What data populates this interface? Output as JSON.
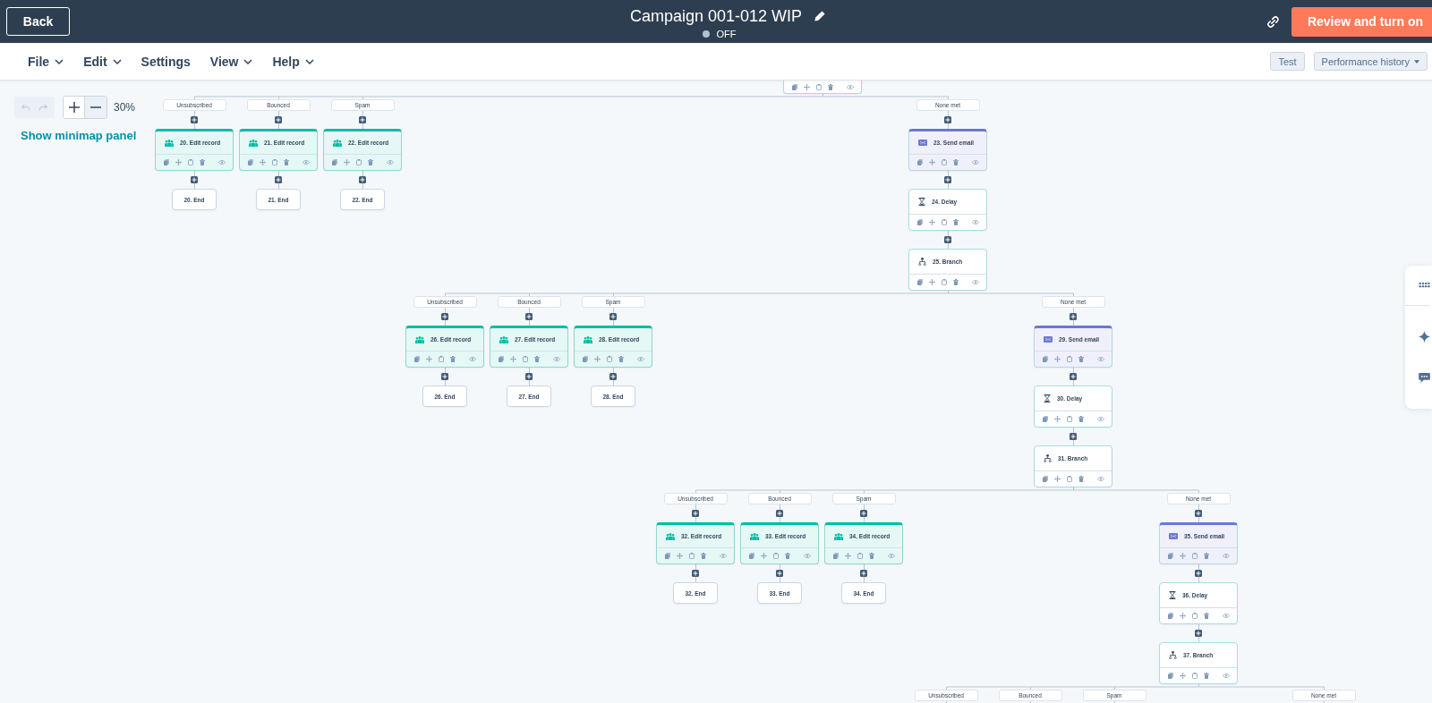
{
  "header": {
    "back_button": "Back",
    "title": "Campaign 001-012 WIP",
    "status": {
      "label": "OFF",
      "on": false
    },
    "primary_button": "Review and turn on"
  },
  "menu_bar": {
    "items": [
      {
        "label": "File",
        "dropdown": true
      },
      {
        "label": "Edit",
        "dropdown": true
      },
      {
        "label": "Settings",
        "dropdown": false
      },
      {
        "label": "View",
        "dropdown": true
      },
      {
        "label": "Help",
        "dropdown": true
      }
    ],
    "actions": [
      {
        "label": "Test",
        "dropdown": false
      },
      {
        "label": "Performance history",
        "dropdown": true
      }
    ]
  },
  "canvas_controls": {
    "undo_disabled": true,
    "redo_disabled": true,
    "zoom_level": "30%",
    "minimap_link": "Show minimap panel"
  },
  "flow": {
    "branches": [
      {
        "label": "Unsubscribed",
        "steps": [
          {
            "kind": "edit_record",
            "title": "20. Edit record"
          },
          {
            "kind": "end",
            "title": "20. End"
          }
        ]
      },
      {
        "label": "Bounced",
        "steps": [
          {
            "kind": "edit_record",
            "title": "21. Edit record"
          },
          {
            "kind": "end",
            "title": "21. End"
          }
        ]
      },
      {
        "label": "Spam",
        "steps": [
          {
            "kind": "edit_record",
            "title": "22. Edit record"
          },
          {
            "kind": "end",
            "title": "22. End"
          }
        ]
      },
      {
        "label": "None met",
        "steps": [
          {
            "kind": "send_email",
            "title": "23. Send email"
          },
          {
            "kind": "delay",
            "title": "24. Delay"
          },
          {
            "kind": "branch",
            "title": "25. Branch",
            "branches": [
              {
                "label": "Unsubscribed",
                "steps": [
                  {
                    "kind": "edit_record",
                    "title": "26. Edit record"
                  },
                  {
                    "kind": "end",
                    "title": "26. End"
                  }
                ]
              },
              {
                "label": "Bounced",
                "steps": [
                  {
                    "kind": "edit_record",
                    "title": "27. Edit record"
                  },
                  {
                    "kind": "end",
                    "title": "27. End"
                  }
                ]
              },
              {
                "label": "Spam",
                "steps": [
                  {
                    "kind": "edit_record",
                    "title": "28. Edit record"
                  },
                  {
                    "kind": "end",
                    "title": "28. End"
                  }
                ]
              },
              {
                "label": "None met",
                "steps": [
                  {
                    "kind": "send_email",
                    "title": "29. Send email"
                  },
                  {
                    "kind": "delay",
                    "title": "30. Delay"
                  },
                  {
                    "kind": "branch",
                    "title": "31. Branch",
                    "branches": [
                      {
                        "label": "Unsubscribed",
                        "steps": [
                          {
                            "kind": "edit_record",
                            "title": "32. Edit record"
                          },
                          {
                            "kind": "end",
                            "title": "32. End"
                          }
                        ]
                      },
                      {
                        "label": "Bounced",
                        "steps": [
                          {
                            "kind": "edit_record",
                            "title": "33. Edit record"
                          },
                          {
                            "kind": "end",
                            "title": "33. End"
                          }
                        ]
                      },
                      {
                        "label": "Spam",
                        "steps": [
                          {
                            "kind": "edit_record",
                            "title": "34. Edit record"
                          },
                          {
                            "kind": "end",
                            "title": "34. End"
                          }
                        ]
                      },
                      {
                        "label": "None met",
                        "steps": [
                          {
                            "kind": "send_email",
                            "title": "35. Send email"
                          },
                          {
                            "kind": "delay",
                            "title": "36. Delay"
                          },
                          {
                            "kind": "branch",
                            "title": "37. Branch",
                            "branches": [
                              {
                                "label": "Unsubscribed"
                              },
                              {
                                "label": "Bounced"
                              },
                              {
                                "label": "Spam"
                              },
                              {
                                "label": "None met"
                              }
                            ]
                          }
                        ]
                      }
                    ]
                  }
                ]
              }
            ]
          }
        ]
      }
    ]
  }
}
